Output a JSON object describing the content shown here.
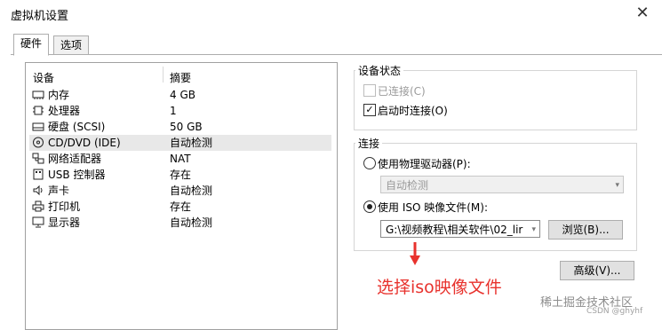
{
  "window": {
    "title": "虚拟机设置"
  },
  "tabs": [
    {
      "label": "硬件"
    },
    {
      "label": "选项"
    }
  ],
  "device_table": {
    "headers": {
      "device": "设备",
      "summary": "摘要"
    },
    "rows": [
      {
        "icon": "memory-icon",
        "name": "内存",
        "summary": "4 GB"
      },
      {
        "icon": "cpu-icon",
        "name": "处理器",
        "summary": "1"
      },
      {
        "icon": "hard-disk-icon",
        "name": "硬盘 (SCSI)",
        "summary": "50 GB"
      },
      {
        "icon": "cd-dvd-icon",
        "name": "CD/DVD (IDE)",
        "summary": "自动检测"
      },
      {
        "icon": "network-adapter-icon",
        "name": "网络适配器",
        "summary": "NAT"
      },
      {
        "icon": "usb-icon",
        "name": "USB 控制器",
        "summary": "存在"
      },
      {
        "icon": "speaker-icon",
        "name": "声卡",
        "summary": "自动检测"
      },
      {
        "icon": "printer-icon",
        "name": "打印机",
        "summary": "存在"
      },
      {
        "icon": "monitor-icon",
        "name": "显示器",
        "summary": "自动检测"
      }
    ],
    "selected_index": 3
  },
  "device_status": {
    "title": "设备状态",
    "connected": {
      "label": "已连接(C)",
      "checked": false,
      "enabled": false
    },
    "connect_at_power_on": {
      "label": "启动时连接(O)",
      "checked": true,
      "check_glyph": "✓"
    }
  },
  "connection": {
    "title": "连接",
    "physical_drive": {
      "label": "使用物理驱动器(P):",
      "selected": false,
      "dropdown_value": "自动检测",
      "arrow": "▾"
    },
    "iso_image": {
      "label": "使用 ISO 映像文件(M):",
      "selected": true,
      "path": "G:\\视频教程\\相关软件\\02_lir",
      "arrow": "▾"
    },
    "browse_button": "浏览(B)..."
  },
  "advanced_button": "高级(V)...",
  "annotation": {
    "text": "选择iso映像文件",
    "color": "#e8322d"
  },
  "watermark": {
    "text": "稀土掘金技术社区",
    "subtext": "CSDN @ghyhf"
  }
}
